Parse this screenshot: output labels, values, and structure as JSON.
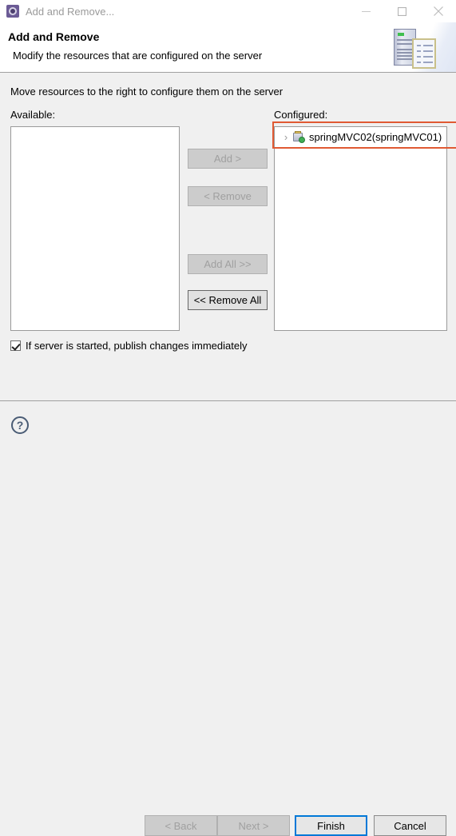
{
  "window": {
    "title": "Add and Remove...",
    "app_icon": "gear-icon",
    "controls": {
      "minimize": "minimize-icon",
      "maximize": "maximize-icon",
      "close": "close-icon"
    }
  },
  "header": {
    "title": "Add and Remove",
    "description": "Modify the resources that are configured on the server",
    "artwork_icon": "server-and-document-icon"
  },
  "main": {
    "instruction": "Move resources to the right to configure them on the server",
    "available": {
      "label": "Available:",
      "items": []
    },
    "configured": {
      "label": "Configured:",
      "items": [
        {
          "label": "springMVC02(springMVC01)",
          "expander": "›",
          "icon": "module-icon",
          "highlighted": true
        }
      ]
    },
    "transfer_buttons": [
      {
        "id": "add",
        "label": "Add >",
        "enabled": false
      },
      {
        "id": "remove",
        "label": "< Remove",
        "enabled": false
      },
      {
        "id": "add_all",
        "label": "Add All >>",
        "enabled": false
      },
      {
        "id": "remove_all",
        "label": "<< Remove All",
        "enabled": true
      }
    ],
    "publish_checkbox": {
      "label": "If server is started, publish changes immediately",
      "checked": true
    }
  },
  "footer": {
    "help_label": "?",
    "buttons": [
      {
        "id": "back",
        "label": "< Back",
        "enabled": false
      },
      {
        "id": "next",
        "label": "Next >",
        "enabled": false
      },
      {
        "id": "finish",
        "label": "Finish",
        "enabled": true,
        "default": true
      },
      {
        "id": "cancel",
        "label": "Cancel",
        "enabled": true
      }
    ]
  },
  "colors": {
    "accent": "#0078d7",
    "highlight_box": "#e05a33",
    "title_icon": "#6b5b95",
    "badge_green": "#3fae54",
    "window_bg": "#f0f0f0"
  }
}
